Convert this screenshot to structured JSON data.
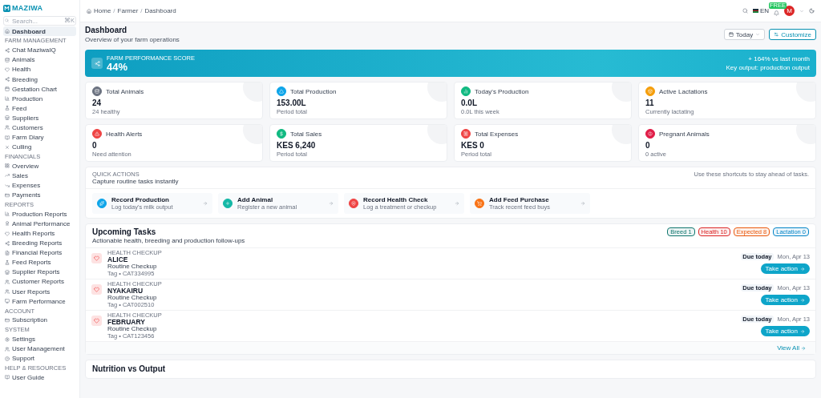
{
  "brand": {
    "name": "MAZIWA"
  },
  "search": {
    "placeholder": "Search...",
    "shortcut": "⌘K"
  },
  "sidebar": {
    "sections": [
      {
        "items": [
          {
            "label": "Dashboard",
            "selected": true
          }
        ]
      },
      {
        "title": "FARM MANAGEMENT",
        "items": [
          {
            "label": "Chat MaziwaIQ",
            "selected": false
          },
          {
            "label": "Animals",
            "selected": false
          },
          {
            "label": "Health",
            "selected": false
          },
          {
            "label": "Breeding",
            "selected": false
          },
          {
            "label": "Gestation Chart",
            "selected": false
          },
          {
            "label": "Production",
            "selected": false
          },
          {
            "label": "Feed",
            "selected": false
          },
          {
            "label": "Suppliers",
            "selected": false
          },
          {
            "label": "Customers",
            "selected": false
          },
          {
            "label": "Farm Diary",
            "selected": false
          },
          {
            "label": "Culling",
            "selected": false
          }
        ]
      },
      {
        "title": "FINANCIALS",
        "items": [
          {
            "label": "Overview",
            "selected": false
          },
          {
            "label": "Sales",
            "selected": false
          },
          {
            "label": "Expenses",
            "selected": false
          },
          {
            "label": "Payments",
            "selected": false
          }
        ]
      },
      {
        "title": "REPORTS",
        "items": [
          {
            "label": "Production Reports",
            "selected": false
          },
          {
            "label": "Animal Performance",
            "selected": false
          },
          {
            "label": "Health Reports",
            "selected": false
          },
          {
            "label": "Breeding Reports",
            "selected": false
          },
          {
            "label": "Financial Reports",
            "selected": false
          },
          {
            "label": "Feed Reports",
            "selected": false
          },
          {
            "label": "Supplier Reports",
            "selected": false
          },
          {
            "label": "Customer Reports",
            "selected": false
          },
          {
            "label": "User Reports",
            "selected": false
          },
          {
            "label": "Farm Performance",
            "selected": false
          }
        ]
      },
      {
        "title": "ACCOUNT",
        "items": [
          {
            "label": "Subscription",
            "selected": false
          }
        ]
      },
      {
        "title": "SYSTEM",
        "items": [
          {
            "label": "Settings",
            "selected": false
          },
          {
            "label": "User Management",
            "selected": false
          },
          {
            "label": "Support",
            "selected": false
          }
        ]
      },
      {
        "title": "HELP & RESOURCES",
        "items": [
          {
            "label": "User Guide",
            "selected": false
          }
        ]
      }
    ]
  },
  "breadcrumb": {
    "separator": "/",
    "items": [
      "Home",
      "Farmer",
      "Dashboard"
    ]
  },
  "topbar": {
    "language": "EN",
    "plan_badge": "FREE",
    "avatar": "M"
  },
  "page": {
    "title": "Dashboard",
    "subtitle": "Overview of your farm operations",
    "period": "Today",
    "customize": "Customize"
  },
  "banner": {
    "label": "FARM PERFORMANCE SCORE",
    "score": "44%",
    "change": "+ 164% vs last month",
    "note": "Key output: production output"
  },
  "stats": [
    {
      "label": "Total Animals",
      "value": "24",
      "sub": "24 healthy",
      "color": "#6b7280"
    },
    {
      "label": "Total Production",
      "value": "153.00L",
      "sub": "Period total",
      "color": "#0ea5e9"
    },
    {
      "label": "Today's Production",
      "value": "0.0L",
      "sub": "0.0L this week",
      "color": "#10b981"
    },
    {
      "label": "Active Lactations",
      "value": "11",
      "sub": "Currently lactating",
      "color": "#f59e0b"
    },
    {
      "label": "Health Alerts",
      "value": "0",
      "sub": "Need attention",
      "color": "#ef4444"
    },
    {
      "label": "Total Sales",
      "value": "KES 6,240",
      "sub": "Period total",
      "color": "#10b981"
    },
    {
      "label": "Total Expenses",
      "value": "KES 0",
      "sub": "Period total",
      "color": "#ef4444"
    },
    {
      "label": "Pregnant Animals",
      "value": "0",
      "sub": "0 active",
      "color": "#e11d48"
    }
  ],
  "quick_actions": {
    "label": "QUICK ACTIONS",
    "title": "Capture routine tasks instantly",
    "hint": "Use these shortcuts to stay ahead of tasks.",
    "items": [
      {
        "title": "Record Production",
        "sub": "Log today's milk output",
        "color": "#0ea5e9"
      },
      {
        "title": "Add Animal",
        "sub": "Register a new animal",
        "color": "#14b8a6"
      },
      {
        "title": "Record Health Check",
        "sub": "Log a treatment or checkup",
        "color": "#ef4444"
      },
      {
        "title": "Add Feed Purchase",
        "sub": "Track recent feed buys",
        "color": "#f97316"
      }
    ]
  },
  "tasks": {
    "title": "Upcoming Tasks",
    "subtitle": "Actionable health, breeding and production follow-ups",
    "chips": [
      {
        "label": "Breed",
        "count": "1",
        "color": "#0f766e"
      },
      {
        "label": "Health",
        "count": "10",
        "color": "#dc2626"
      },
      {
        "label": "Expected",
        "count": "8",
        "color": "#ea580c"
      },
      {
        "label": "Lactation",
        "count": "0",
        "color": "#0284c7"
      }
    ],
    "items": [
      {
        "type": "HEALTH CHECKUP",
        "name": "ALICE",
        "task": "Routine Checkup",
        "tag": "Tag • CAT334995",
        "due": "Due today",
        "date": "Mon, Apr 13",
        "action": "Take action"
      },
      {
        "type": "HEALTH CHECKUP",
        "name": "NYAKAIRU",
        "task": "Routine Checkup",
        "tag": "Tag • CAT002510",
        "due": "Due today",
        "date": "Mon, Apr 13",
        "action": "Take action"
      },
      {
        "type": "HEALTH CHECKUP",
        "name": "FEBRUARY",
        "task": "Routine Checkup",
        "tag": "Tag • CAT123456",
        "due": "Due today",
        "date": "Mon, Apr 13",
        "action": "Take action"
      }
    ],
    "view_all": "View All"
  },
  "nutrition": {
    "title": "Nutrition vs Output"
  }
}
